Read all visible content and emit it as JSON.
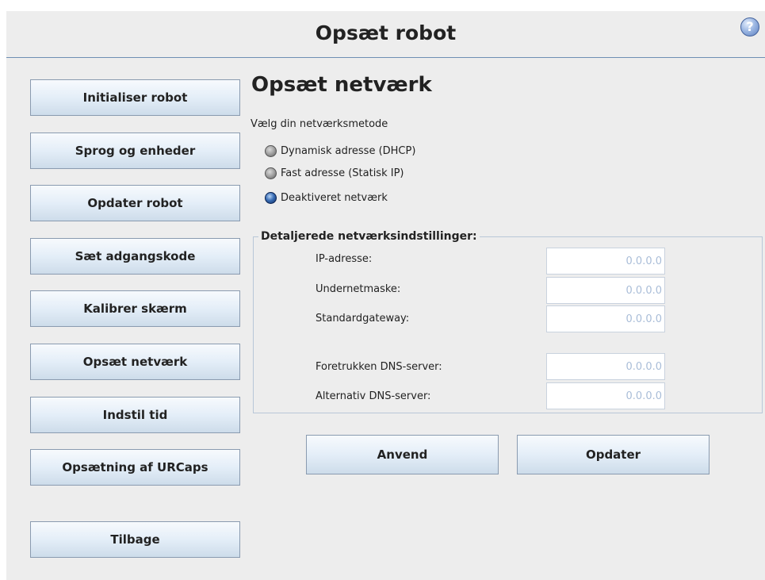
{
  "header": {
    "title": "Opsæt robot",
    "help_glyph": "?",
    "help_icon": "help-circle-icon"
  },
  "sidebar": {
    "items": [
      {
        "label": "Initialiser robot"
      },
      {
        "label": "Sprog og enheder"
      },
      {
        "label": "Opdater robot"
      },
      {
        "label": "Sæt adgangskode"
      },
      {
        "label": "Kalibrer skærm"
      },
      {
        "label": "Opsæt netværk"
      },
      {
        "label": "Indstil tid"
      },
      {
        "label": "Opsætning af URCaps"
      }
    ],
    "back_label": "Tilbage"
  },
  "main": {
    "title": "Opsæt netværk",
    "method_prompt": "Vælg din netværksmetode",
    "methods": [
      {
        "label": "Dynamisk adresse (DHCP)",
        "selected": false
      },
      {
        "label": "Fast adresse (Statisk IP)",
        "selected": false
      },
      {
        "label": "Deaktiveret netværk",
        "selected": true
      }
    ],
    "details": {
      "legend": "Detaljerede netværksindstillinger:",
      "fields": [
        {
          "label": "IP-adresse:",
          "value": "0.0.0.0"
        },
        {
          "label": "Undernetmaske:",
          "value": "0.0.0.0"
        },
        {
          "label": "Standardgateway:",
          "value": "0.0.0.0"
        },
        {
          "label": "Foretrukken DNS-server:",
          "value": "0.0.0.0"
        },
        {
          "label": "Alternativ DNS-server:",
          "value": "0.0.0.0"
        }
      ]
    },
    "apply_label": "Anvend",
    "update_label": "Opdater"
  },
  "colors": {
    "accent_line": "#6f8fb4",
    "field_text": "#a9bdd8",
    "radio_selected": "#3b6fb6"
  }
}
